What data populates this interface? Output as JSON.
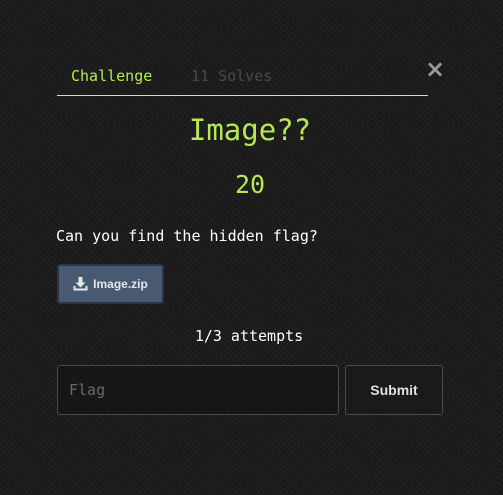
{
  "tabs": {
    "challenge_label": "Challenge",
    "solves_label": "11 Solves"
  },
  "close_label": "×",
  "challenge": {
    "name": "Image??",
    "value": "20",
    "description": "Can you find the hidden flag?",
    "file_label": "Image.zip",
    "file_icon": "download-icon"
  },
  "attempts": "1/3 attempts",
  "flag_input": {
    "placeholder": "Flag",
    "value": ""
  },
  "submit_label": "Submit",
  "colors": {
    "accent": "#b5e853",
    "muted_tab": "#4a4a4a",
    "file_button": "#485a72",
    "background": "#1c1c1c"
  }
}
